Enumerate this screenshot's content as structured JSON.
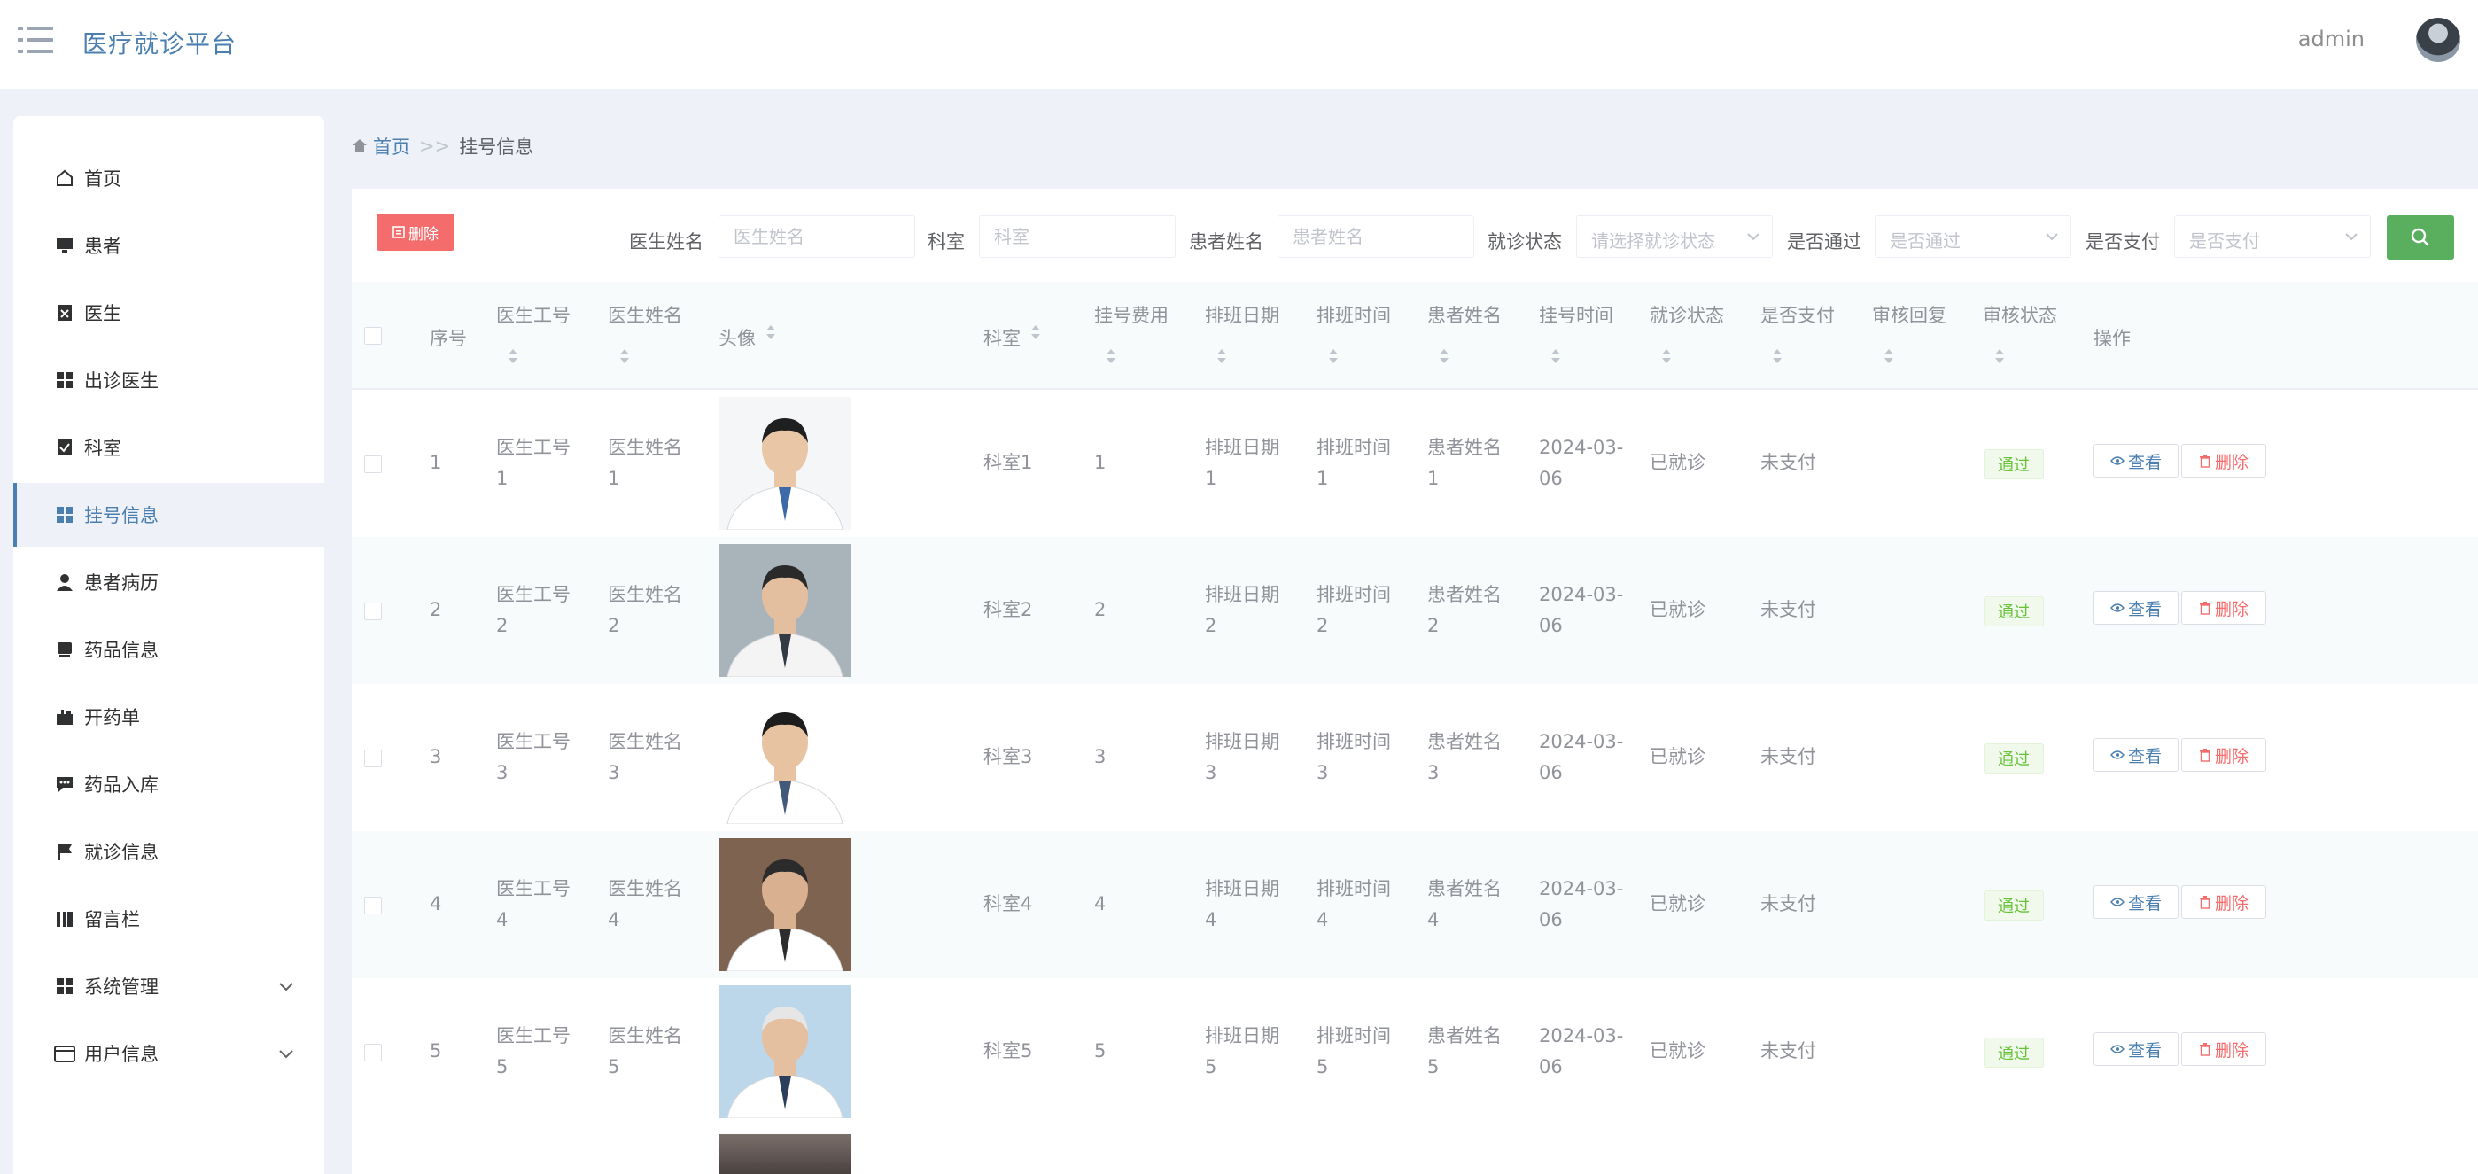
{
  "header": {
    "title": "医疗就诊平台",
    "user": "admin"
  },
  "sidebar": {
    "items": [
      {
        "label": "首页"
      },
      {
        "label": "患者"
      },
      {
        "label": "医生"
      },
      {
        "label": "出诊医生"
      },
      {
        "label": "科室"
      },
      {
        "label": "挂号信息"
      },
      {
        "label": "患者病历"
      },
      {
        "label": "药品信息"
      },
      {
        "label": "开药单"
      },
      {
        "label": "药品入库"
      },
      {
        "label": "就诊信息"
      },
      {
        "label": "留言栏"
      },
      {
        "label": "系统管理"
      },
      {
        "label": "用户信息"
      }
    ]
  },
  "breadcrumb": {
    "home": "首页",
    "sep": ">>",
    "current": "挂号信息"
  },
  "toolbar": {
    "delete_label": "删除"
  },
  "filters": {
    "doctor_name": {
      "label": "医生姓名",
      "placeholder": "医生姓名"
    },
    "department": {
      "label": "科室",
      "placeholder": "科室"
    },
    "patient_name": {
      "label": "患者姓名",
      "placeholder": "患者姓名"
    },
    "visit_status": {
      "label": "就诊状态",
      "placeholder": "请选择就诊状态"
    },
    "approved": {
      "label": "是否通过",
      "placeholder": "是否通过"
    },
    "paid": {
      "label": "是否支付",
      "placeholder": "是否支付"
    }
  },
  "table": {
    "headers": {
      "index": "序号",
      "doctor_no": "医生工号",
      "doctor_name": "医生姓名",
      "photo": "头像",
      "department": "科室",
      "fee": "挂号费用",
      "date": "排班日期",
      "time": "排班时间",
      "patient": "患者姓名",
      "reg_time": "挂号时间",
      "visit_status": "就诊状态",
      "paid": "是否支付",
      "reply": "审核回复",
      "audit": "审核状态",
      "ops": "操作"
    },
    "rows": [
      {
        "index": "1",
        "doctor_no_a": "医生工号",
        "doctor_no_b": "1",
        "doctor_name_a": "医生姓名",
        "doctor_name_b": "1",
        "department": "科室1",
        "fee": "1",
        "date_a": "排班日期",
        "date_b": "1",
        "time_a": "排班时间",
        "time_b": "1",
        "patient_a": "患者姓名",
        "patient_b": "1",
        "reg_a": "2024-03-",
        "reg_b": "06",
        "visit_status": "已就诊",
        "paid": "未支付",
        "audit": "通过",
        "view": "查看",
        "delete": "删除"
      },
      {
        "index": "2",
        "doctor_no_a": "医生工号",
        "doctor_no_b": "2",
        "doctor_name_a": "医生姓名",
        "doctor_name_b": "2",
        "department": "科室2",
        "fee": "2",
        "date_a": "排班日期",
        "date_b": "2",
        "time_a": "排班时间",
        "time_b": "2",
        "patient_a": "患者姓名",
        "patient_b": "2",
        "reg_a": "2024-03-",
        "reg_b": "06",
        "visit_status": "已就诊",
        "paid": "未支付",
        "audit": "通过",
        "view": "查看",
        "delete": "删除"
      },
      {
        "index": "3",
        "doctor_no_a": "医生工号",
        "doctor_no_b": "3",
        "doctor_name_a": "医生姓名",
        "doctor_name_b": "3",
        "department": "科室3",
        "fee": "3",
        "date_a": "排班日期",
        "date_b": "3",
        "time_a": "排班时间",
        "time_b": "3",
        "patient_a": "患者姓名",
        "patient_b": "3",
        "reg_a": "2024-03-",
        "reg_b": "06",
        "visit_status": "已就诊",
        "paid": "未支付",
        "audit": "通过",
        "view": "查看",
        "delete": "删除"
      },
      {
        "index": "4",
        "doctor_no_a": "医生工号",
        "doctor_no_b": "4",
        "doctor_name_a": "医生姓名",
        "doctor_name_b": "4",
        "department": "科室4",
        "fee": "4",
        "date_a": "排班日期",
        "date_b": "4",
        "time_a": "排班时间",
        "time_b": "4",
        "patient_a": "患者姓名",
        "patient_b": "4",
        "reg_a": "2024-03-",
        "reg_b": "06",
        "visit_status": "已就诊",
        "paid": "未支付",
        "audit": "通过",
        "view": "查看",
        "delete": "删除"
      },
      {
        "index": "5",
        "doctor_no_a": "医生工号",
        "doctor_no_b": "5",
        "doctor_name_a": "医生姓名",
        "doctor_name_b": "5",
        "department": "科室5",
        "fee": "5",
        "date_a": "排班日期",
        "date_b": "5",
        "time_a": "排班时间",
        "time_b": "5",
        "patient_a": "患者姓名",
        "patient_b": "5",
        "reg_a": "2024-03-",
        "reg_b": "06",
        "visit_status": "已就诊",
        "paid": "未支付",
        "audit": "通过",
        "view": "查看",
        "delete": "删除"
      }
    ]
  },
  "colors": {
    "accent": "#4a7fb0",
    "danger": "#f56c6c",
    "success": "#5aaf5f",
    "tag_green": "#67c23a"
  }
}
